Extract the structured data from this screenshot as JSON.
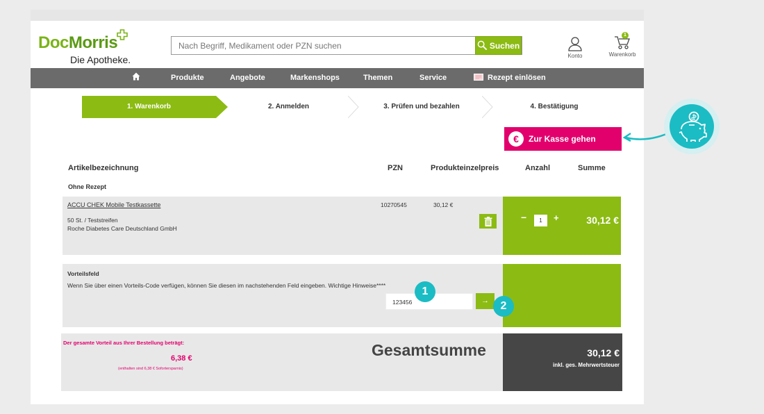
{
  "header": {
    "logo_main_1": "Doc",
    "logo_main_2": "Morris",
    "logo_sub": "Die Apotheke.",
    "search_placeholder": "Nach Begriff, Medikament oder PZN suchen",
    "search_button": "Suchen",
    "account_label": "Konto",
    "cart_label": "Warenkorb",
    "cart_count": "1"
  },
  "nav": {
    "items": [
      "Produkte",
      "Angebote",
      "Markenshops",
      "Themen",
      "Service",
      "Rezept einlösen"
    ]
  },
  "steps": [
    "1. Warenkorb",
    "2. Anmelden",
    "3. Prüfen und bezahlen",
    "4. Bestätigung"
  ],
  "checkout_button": "Zur Kasse gehen",
  "table": {
    "headers": [
      "Artikelbezeichnung",
      "PZN",
      "Produkteinzelpreis",
      "Anzahl",
      "Summe"
    ],
    "section": "Ohne Rezept",
    "item": {
      "name": "ACCU CHEK Mobile Testkassette",
      "meta1": "50 St. / Teststreifen",
      "meta2": "Roche Diabetes Care Deutschland GmbH",
      "pzn": "10270545",
      "unit_price": "30,12 €",
      "qty_minus": "−",
      "qty": "1",
      "qty_plus": "+",
      "sum": "30,12 €"
    }
  },
  "voucher": {
    "title": "Vorteilsfeld",
    "text": "Wenn Sie über einen Vorteils-Code verfügen, können Sie diesen im nachstehenden Feld eingeben. Wichtige Hinweise****",
    "code_value": "123456",
    "submit": "→"
  },
  "totals": {
    "savings_label": "Der gesamte Vorteil aus Ihrer Bestellung beträgt:",
    "savings_value": "6,38 €",
    "savings_note": "(enthalten sind 6,38 € Sofortersparnis)",
    "gesamt_label": "Gesamtsumme",
    "total_value": "30,12 €",
    "total_note": "inkl. ges. Mehrwertsteuer"
  },
  "callouts": [
    "1",
    "2"
  ],
  "colors": {
    "brand_green": "#8cbb13",
    "checkout_pink": "#e2006d",
    "callout_teal": "#1bbcc4",
    "nav_gray": "#6b6b6b"
  },
  "icons": [
    "home-icon",
    "search-icon",
    "user-icon",
    "cart-icon",
    "prescription-icon",
    "euro-icon",
    "trash-icon",
    "piggy-bank-icon"
  ]
}
